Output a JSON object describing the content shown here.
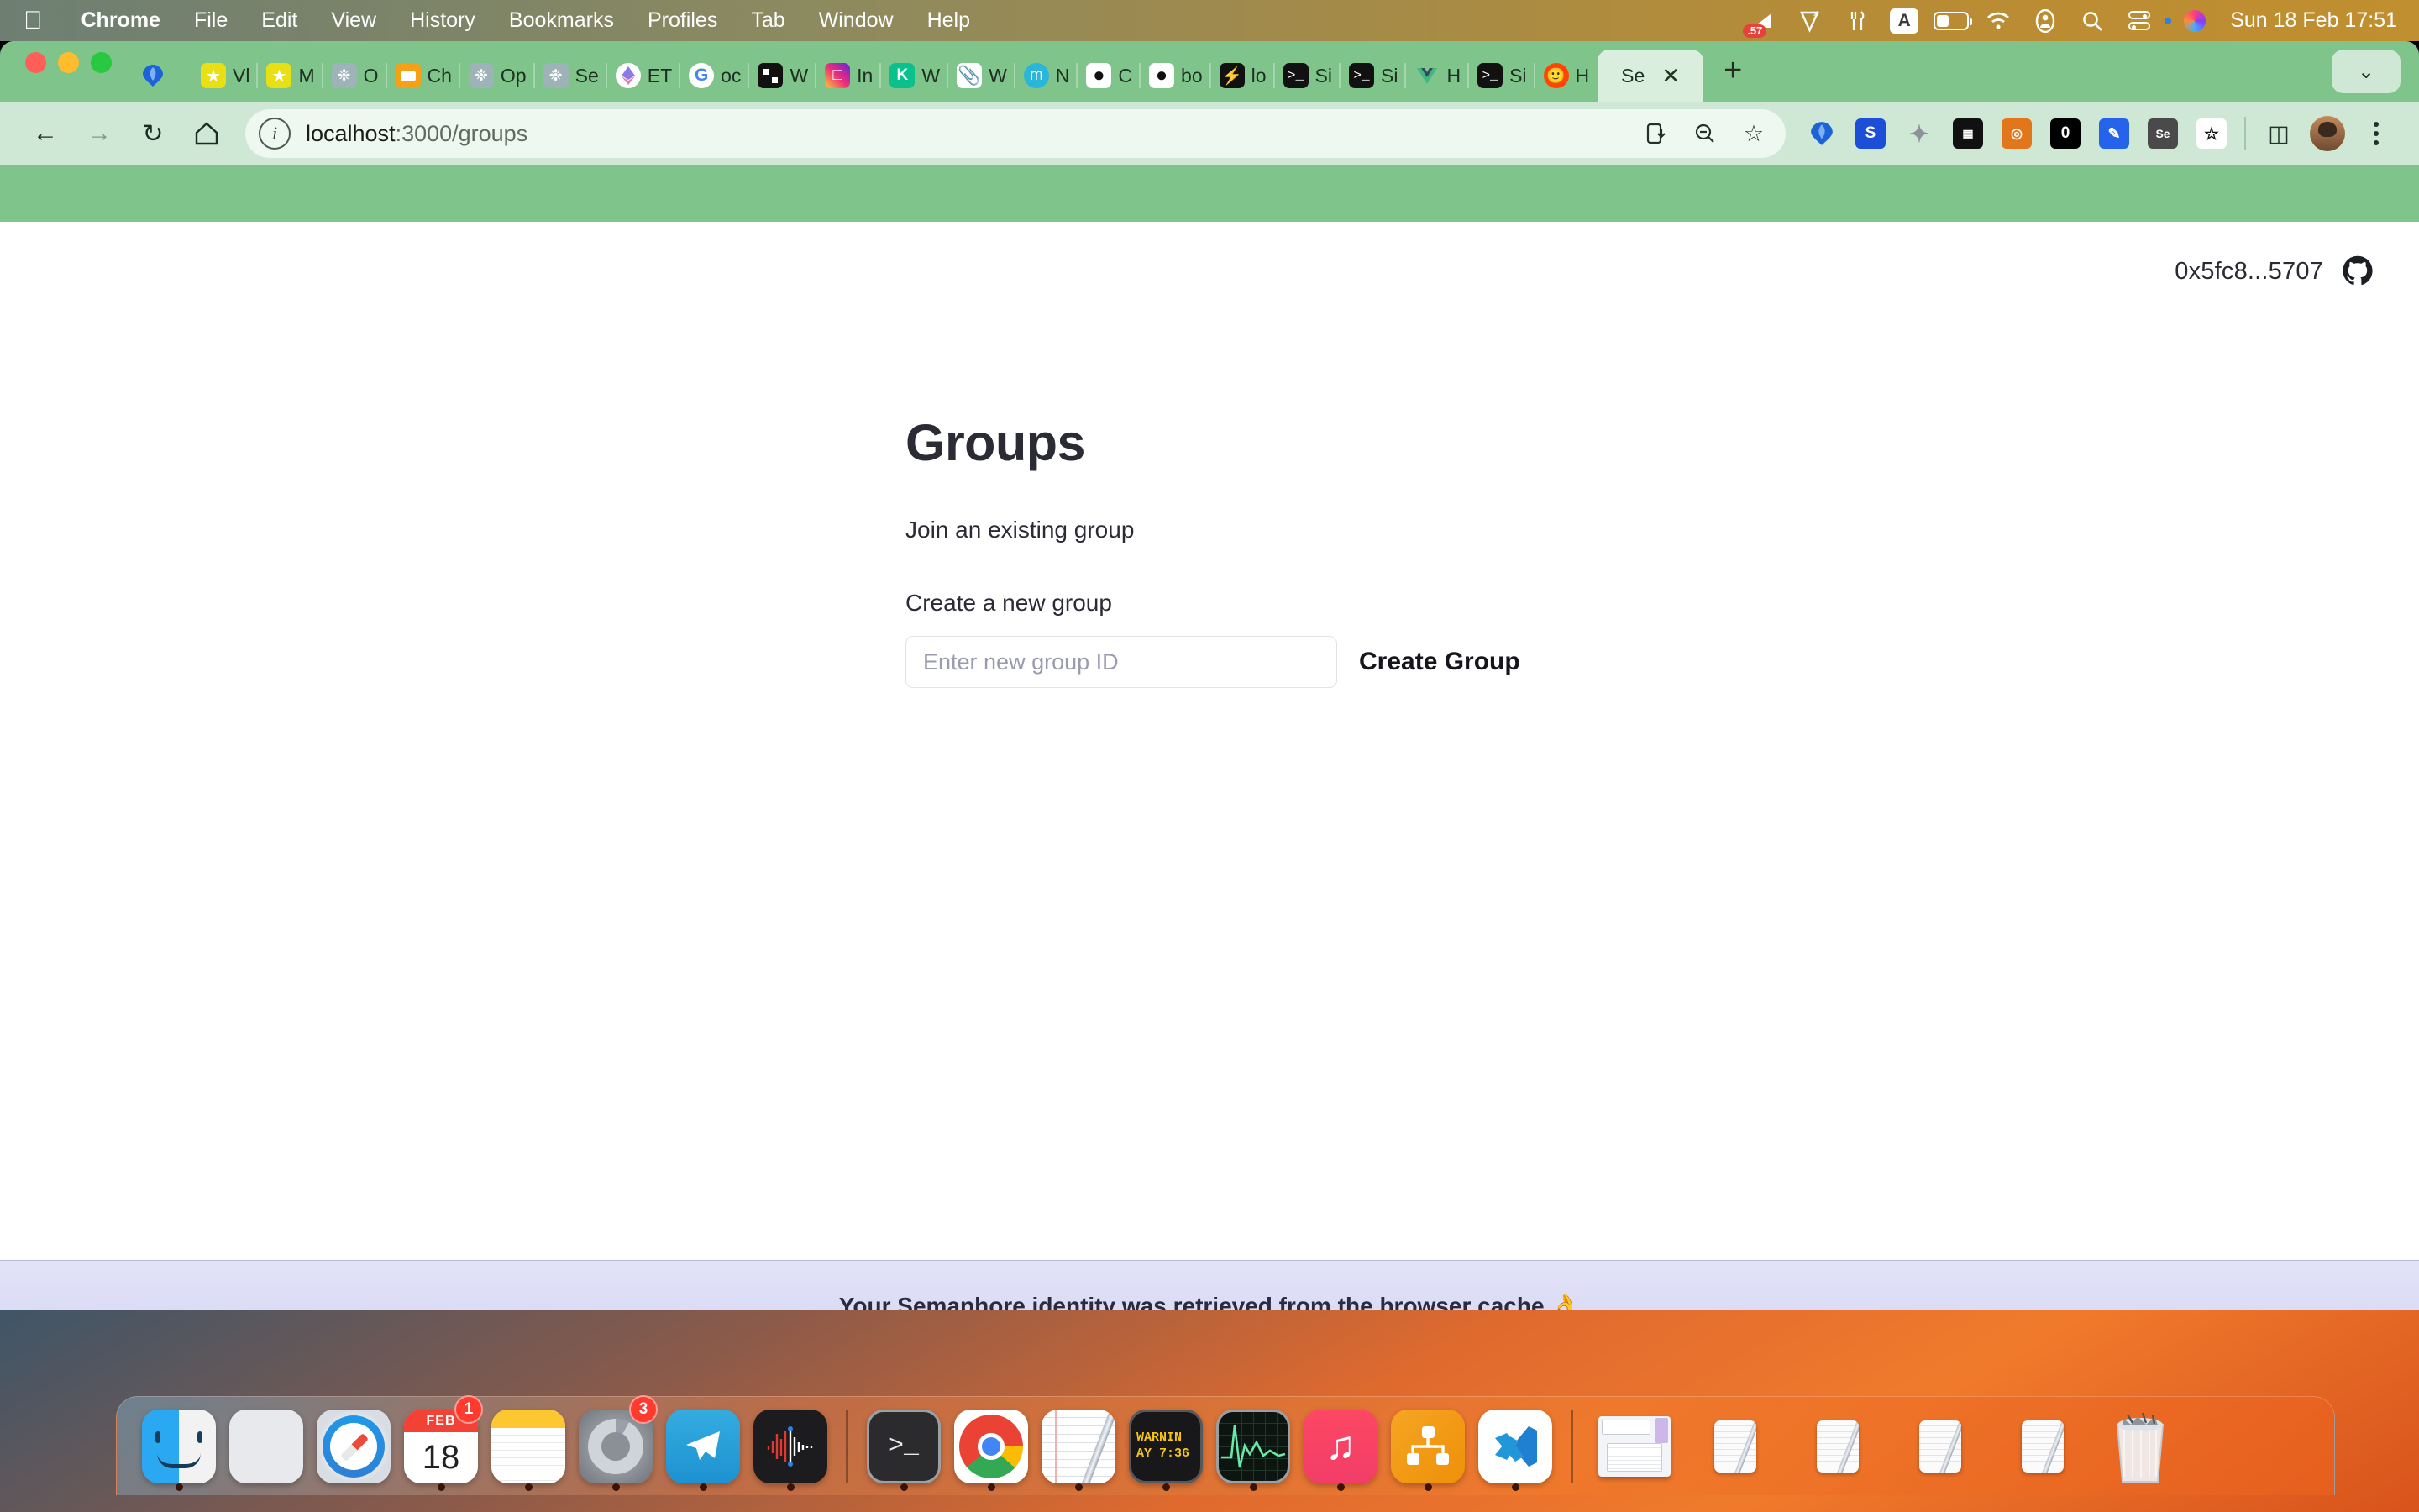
{
  "menubar": {
    "apple_glyph": "",
    "items": [
      "Chrome",
      "File",
      "Edit",
      "View",
      "History",
      "Bookmarks",
      "Profiles",
      "Tab",
      "Window",
      "Help"
    ],
    "app_name": "Chrome",
    "status_icons": [
      "stats-badge-icon",
      "location-off-icon",
      "utensils-icon",
      "input-source-A-icon",
      "battery-icon",
      "wifi-icon",
      "user-account-icon",
      "spotlight-search-icon",
      "control-center-icon",
      "siri-icon"
    ],
    "stats_badge": ".57",
    "input_source": "A",
    "clock": "Sun 18 Feb  17:51"
  },
  "browser": {
    "tabs": [
      {
        "title": "Vl",
        "icon": "star-yellow-icon"
      },
      {
        "title": "M",
        "icon": "star-yellow-icon"
      },
      {
        "title": "O",
        "icon": "openai-icon"
      },
      {
        "title": "Ch",
        "icon": "orange-window-icon"
      },
      {
        "title": "Op",
        "icon": "openai-icon"
      },
      {
        "title": "Se",
        "icon": "openai-icon"
      },
      {
        "title": "ET",
        "icon": "ethereum-icon"
      },
      {
        "title": "oc",
        "icon": "google-icon"
      },
      {
        "title": "W",
        "icon": "checker-icon"
      },
      {
        "title": "In",
        "icon": "instagram-icon"
      },
      {
        "title": "W",
        "icon": "kucoin-icon"
      },
      {
        "title": "W",
        "icon": "paperclip-icon"
      },
      {
        "title": "N",
        "icon": "medium-m-icon"
      },
      {
        "title": "C",
        "icon": "github-icon"
      },
      {
        "title": "bo",
        "icon": "github-icon"
      },
      {
        "title": "lo",
        "icon": "lightning-icon"
      },
      {
        "title": "Si",
        "icon": "terminal-icon"
      },
      {
        "title": "Si",
        "icon": "terminal-icon"
      },
      {
        "title": "H",
        "icon": "vue-icon"
      },
      {
        "title": "Si",
        "icon": "terminal-icon"
      },
      {
        "title": "H",
        "icon": "reddit-icon"
      }
    ],
    "active_tab": {
      "title": "Se",
      "close_glyph": "✕"
    },
    "new_tab_glyph": "+",
    "tab_list_glyph": "⌄",
    "nav": {
      "back_glyph": "←",
      "forward_glyph": "→",
      "reload_glyph": "↻",
      "home_glyph": "⌂"
    },
    "omnibox": {
      "info_glyph": "i",
      "url_host": "localhost",
      "url_path": ":3000/groups",
      "full_url": "localhost:3000/groups",
      "install_glyph": "⬇",
      "zoom_out_glyph": "⊖",
      "bookmark_glyph": "☆"
    },
    "extensions": [
      {
        "name": "vl-balloon-ext",
        "label": "▼",
        "bg": "#1956c8",
        "fg": "#ffffff"
      },
      {
        "name": "scribe-s-ext",
        "label": "S",
        "bg": "#1d4ed8",
        "fg": "#ffffff"
      },
      {
        "name": "ghost-gray-ext",
        "label": "◆",
        "bg": "#9aa0a6",
        "fg": "#ffffff"
      },
      {
        "name": "checker-dark-ext",
        "label": "▒",
        "bg": "#111111",
        "fg": "#ffffff"
      },
      {
        "name": "metamask-fox-ext",
        "label": "◈",
        "bg": "#e2761b",
        "fg": "#ffffff"
      },
      {
        "name": "zero-dark-ext",
        "label": "0",
        "bg": "#000000",
        "fg": "#ffffff"
      },
      {
        "name": "blue-pen-ext",
        "label": "✒",
        "bg": "#2563eb",
        "fg": "#ffffff"
      },
      {
        "name": "selenium-ext",
        "label": "Se",
        "bg": "#4a4a4a",
        "fg": "#ffffff"
      },
      {
        "name": "bottle-ext",
        "label": "▯",
        "bg": "#ffffff",
        "fg": "#111111"
      },
      {
        "name": "puzzle-ext",
        "label": "⧉",
        "bg": "#ffffff",
        "fg": "#222222"
      }
    ],
    "side_panel_glyph": "◫",
    "profile_name": "avatar",
    "menu_glyph": "kebab"
  },
  "page": {
    "wallet_address": "0x5fc8...5707",
    "github_icon": "github-icon",
    "title": "Groups",
    "join_link": "Join an existing group",
    "create_label": "Create a new group",
    "input_placeholder": "Enter new group ID",
    "input_value": "",
    "create_button": "Create Group",
    "banner_text": "Your Semaphore identity was retrieved from the browser cache 👌",
    "colors": {
      "banner_bg": "#dcddf5",
      "text": "#2b2b36",
      "placeholder": "#9a9ab0",
      "input_border": "#e2e2e8"
    }
  },
  "dock": {
    "items": [
      {
        "name": "finder",
        "label": "Finder",
        "badge": null,
        "running": true
      },
      {
        "name": "launchpad",
        "label": "Launchpad",
        "badge": null,
        "running": false
      },
      {
        "name": "safari",
        "label": "Safari",
        "badge": null,
        "running": false
      },
      {
        "name": "calendar",
        "label": "Calendar",
        "month": "FEB",
        "day": "18",
        "badge": "1",
        "running": true
      },
      {
        "name": "notes",
        "label": "Notes",
        "badge": null,
        "running": true
      },
      {
        "name": "system-settings",
        "label": "System Settings",
        "badge": "3",
        "running": true
      },
      {
        "name": "telegram",
        "label": "Telegram",
        "badge": null,
        "running": true
      },
      {
        "name": "voice-memos",
        "label": "Voice Memos",
        "badge": null,
        "running": true
      },
      {
        "name": "terminal",
        "label": "Terminal",
        "badge": null,
        "running": true
      },
      {
        "name": "chrome",
        "label": "Google Chrome",
        "badge": null,
        "running": true
      },
      {
        "name": "textedit",
        "label": "TextEdit",
        "badge": null,
        "running": true
      },
      {
        "name": "warning-widget",
        "label": "WARNING",
        "line1": "WARNIN",
        "line2": "AY 7:36",
        "badge": null,
        "running": true
      },
      {
        "name": "activity-monitor",
        "label": "Activity Monitor",
        "badge": null,
        "running": true
      },
      {
        "name": "music",
        "label": "Music",
        "badge": null,
        "running": true
      },
      {
        "name": "tree-app",
        "label": "Tree App",
        "badge": null,
        "running": true
      },
      {
        "name": "vscode",
        "label": "Visual Studio Code",
        "badge": null,
        "running": true
      }
    ],
    "stacks": [
      {
        "name": "documents-stack",
        "label": "Documents"
      },
      {
        "name": "minimized-doc-1",
        "label": "Untitled 1"
      },
      {
        "name": "minimized-doc-2",
        "label": "Untitled 2"
      },
      {
        "name": "minimized-doc-3",
        "label": "Untitled 3"
      },
      {
        "name": "minimized-doc-4",
        "label": "Untitled 4"
      }
    ],
    "trash": {
      "name": "trash",
      "label": "Trash"
    }
  }
}
